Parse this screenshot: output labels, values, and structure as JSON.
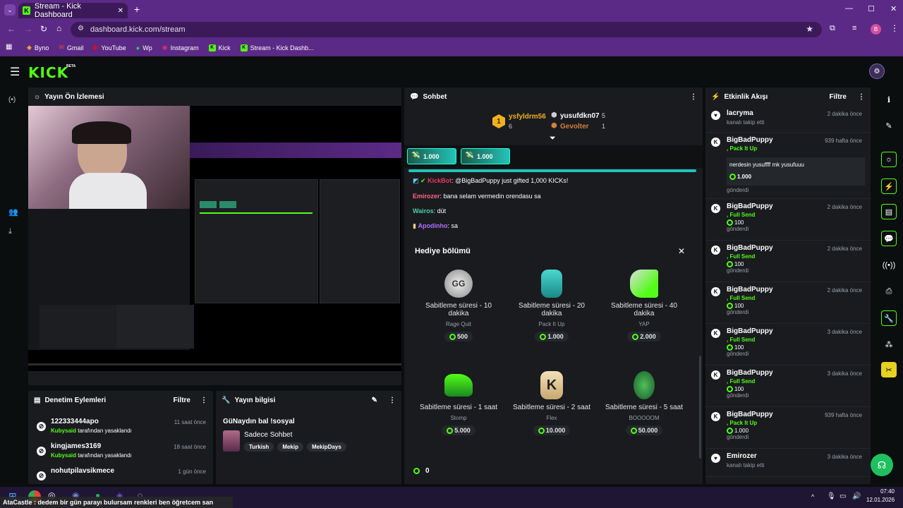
{
  "browser": {
    "tab_title": "Stream - Kick Dashboard",
    "url": "dashboard.kick.com/stream",
    "profile_initial": "B",
    "bookmarks": [
      "Byno",
      "Gmail",
      "YouTube",
      "Wp",
      "Instagram",
      "Kick",
      "Stream - Kick Dashb..."
    ]
  },
  "nav": {
    "logo": "KICK",
    "beta": "BETA"
  },
  "preview": {
    "title": "Yayın Ön İzlemesi"
  },
  "chat": {
    "title": "Sohbet",
    "leaderboard": {
      "first": {
        "rank": "1",
        "name": "ysfyldrm56",
        "count": "6"
      },
      "second": {
        "name": "yusufdkn07",
        "count": "5"
      },
      "third": {
        "name": "Gevolter",
        "count": "1"
      }
    },
    "pinned": [
      "1.000",
      "1.000"
    ],
    "messages": [
      {
        "user": "KickBot",
        "text": ": @BigBadPuppy just gifted 1,000 KICKs!"
      },
      {
        "user": "Emirozer",
        "text": ": bana selam vermedin orendasu sa"
      },
      {
        "user": "Wairos",
        "text": ": düt"
      },
      {
        "user": "Apodinho",
        "text": ": sa"
      }
    ],
    "gift_title": "Hediye bölümü",
    "gifts": [
      {
        "title": "Sabitleme süresi - 10 dakika",
        "name": "Rage Quit",
        "price": "500"
      },
      {
        "title": "Sabitleme süresi - 20 dakika",
        "name": "Pack It Up",
        "price": "1.000"
      },
      {
        "title": "Sabitleme süresi - 40 dakika",
        "name": "YAP",
        "price": "2.000"
      },
      {
        "title": "Sabitleme süresi - 1 saat",
        "name": "Stomp",
        "price": "5.000"
      },
      {
        "title": "Sabitleme süresi - 2 saat",
        "name": "Flex",
        "price": "10.000"
      },
      {
        "title": "Sabitleme süresi - 5 saat",
        "name": "BOOOOOM",
        "price": "50.000"
      }
    ],
    "balance": "0"
  },
  "feed": {
    "title": "Etkinlik Akışı",
    "filter": "Filtre",
    "items": [
      {
        "name": "lacryma",
        "sub": "kanalı takip etti",
        "time": "2 dakika önce"
      },
      {
        "name": "BigBadPuppy",
        "sub": ", Pack It Up",
        "time": "939 hafta önce",
        "msg": "nerdesin yusuffff mk yusufuuu",
        "amount": "1.000",
        "tail": "gönderdi"
      },
      {
        "name": "BigBadPuppy",
        "sub": ", Full Send",
        "time": "2 dakika önce",
        "amount": "100",
        "tail": "gönderdi"
      },
      {
        "name": "BigBadPuppy",
        "sub": ", Full Send",
        "time": "2 dakika önce",
        "amount": "100",
        "tail": "gönderdi"
      },
      {
        "name": "BigBadPuppy",
        "sub": ", Full Send",
        "time": "2 dakika önce",
        "amount": "100",
        "tail": "gönderdi"
      },
      {
        "name": "BigBadPuppy",
        "sub": ", Full Send",
        "time": "3 dakika önce",
        "amount": "100",
        "tail": "gönderdi"
      },
      {
        "name": "BigBadPuppy",
        "sub": ", Full Send",
        "time": "3 dakika önce",
        "amount": "100",
        "tail": "gönderdi"
      },
      {
        "name": "BigBadPuppy",
        "sub": ", Pack It Up",
        "time": "939 hafta önce",
        "amount": "1.000",
        "tail": "gönderdi"
      },
      {
        "name": "Emirozer",
        "sub": "kanalı takip etti",
        "time": "3 dakika önce"
      }
    ]
  },
  "mod": {
    "title": "Denetim Eylemleri",
    "filter": "Filtre",
    "rows": [
      {
        "user": "122333444apo",
        "by": "Kubysaid",
        "action": "tarafından yasaklandı",
        "time": "11 saat önce"
      },
      {
        "user": "kingjames3169",
        "by": "Kubysaid",
        "action": "tarafından yasaklandı",
        "time": "18 saat önce"
      },
      {
        "user": "nohutpilavsikmece",
        "by": "",
        "action": "",
        "time": "1 gün önce"
      }
    ]
  },
  "info": {
    "title": "Yayın bilgisi",
    "stream_title": "GüNaydın bal !sosyal",
    "category": "Sadece Sohbet",
    "tags": [
      "Turkish",
      "Mekip",
      "MekipDays"
    ]
  },
  "taskbar": {
    "ticker": "AtaCastle : dedem bir gün parayı bulursam renkleri ben öğretcem san",
    "time": "07:40",
    "date": "12.01.2026"
  }
}
